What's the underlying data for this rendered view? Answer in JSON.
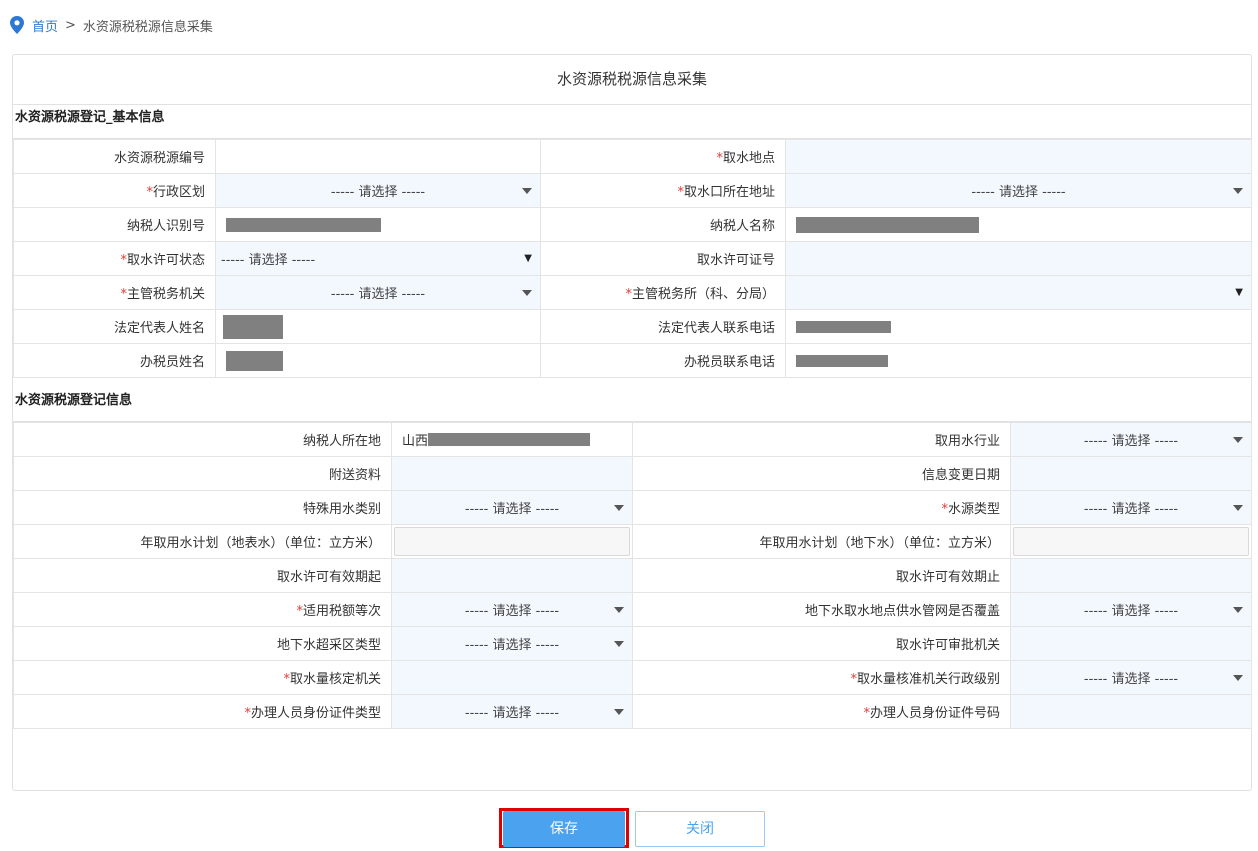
{
  "breadcrumb": {
    "home": "首页",
    "separator": ">",
    "current": "水资源税税源信息采集"
  },
  "panel_title": "水资源税税源信息采集",
  "required_mark": "*",
  "select_placeholder": "----- 请选择 -----",
  "basic_section": {
    "title": "水资源税源登记_基本信息",
    "rows": [
      {
        "l1": "水资源税源编号",
        "l1_req": false,
        "l2": "取水地点",
        "l2_req": true
      },
      {
        "l1": "行政区划",
        "l1_req": true,
        "l2": "取水口所在地址",
        "l2_req": true
      },
      {
        "l1": "纳税人识别号",
        "l1_req": false,
        "l2": "纳税人名称",
        "l2_req": false
      },
      {
        "l1": "取水许可状态",
        "l1_req": true,
        "l2": "取水许可证号",
        "l2_req": false
      },
      {
        "l1": "主管税务机关",
        "l1_req": true,
        "l2": "主管税务所（科、分局）",
        "l2_req": true
      },
      {
        "l1": "法定代表人姓名",
        "l1_req": false,
        "l2": "法定代表人联系电话",
        "l2_req": false
      },
      {
        "l1": "办税员姓名",
        "l1_req": false,
        "l2": "办税员联系电话",
        "l2_req": false
      }
    ]
  },
  "reg_section": {
    "title": "水资源税源登记信息",
    "taxpayer_location_value": "山西",
    "rows": [
      {
        "l1": "纳税人所在地",
        "l1_req": false,
        "l2": "取用水行业",
        "l2_req": false
      },
      {
        "l1": "附送资料",
        "l1_req": false,
        "l2": "信息变更日期",
        "l2_req": false
      },
      {
        "l1": "特殊用水类别",
        "l1_req": false,
        "l2": "水源类型",
        "l2_req": true
      },
      {
        "l1": "年取用水计划（地表水）（单位：立方米）",
        "l1_req": false,
        "l2": "年取用水计划（地下水）（单位：立方米）",
        "l2_req": false
      },
      {
        "l1": "取水许可有效期起",
        "l1_req": false,
        "l2": "取水许可有效期止",
        "l2_req": false
      },
      {
        "l1": "适用税额等次",
        "l1_req": true,
        "l2": "地下水取水地点供水管网是否覆盖",
        "l2_req": false
      },
      {
        "l1": "地下水超采区类型",
        "l1_req": false,
        "l2": "取水许可审批机关",
        "l2_req": false
      },
      {
        "l1": "取水量核定机关",
        "l1_req": true,
        "l2": "取水量核准机关行政级别",
        "l2_req": true
      },
      {
        "l1": "办理人员身份证件类型",
        "l1_req": true,
        "l2": "办理人员身份证件号码",
        "l2_req": true
      }
    ]
  },
  "buttons": {
    "save": "保存",
    "close": "关闭"
  },
  "colors": {
    "accent": "#4ba3ef",
    "link": "#2d78d6",
    "required": "#e53935",
    "highlight": "#e00000",
    "field_bg": "#f3f8ff",
    "mask": "#808080"
  }
}
